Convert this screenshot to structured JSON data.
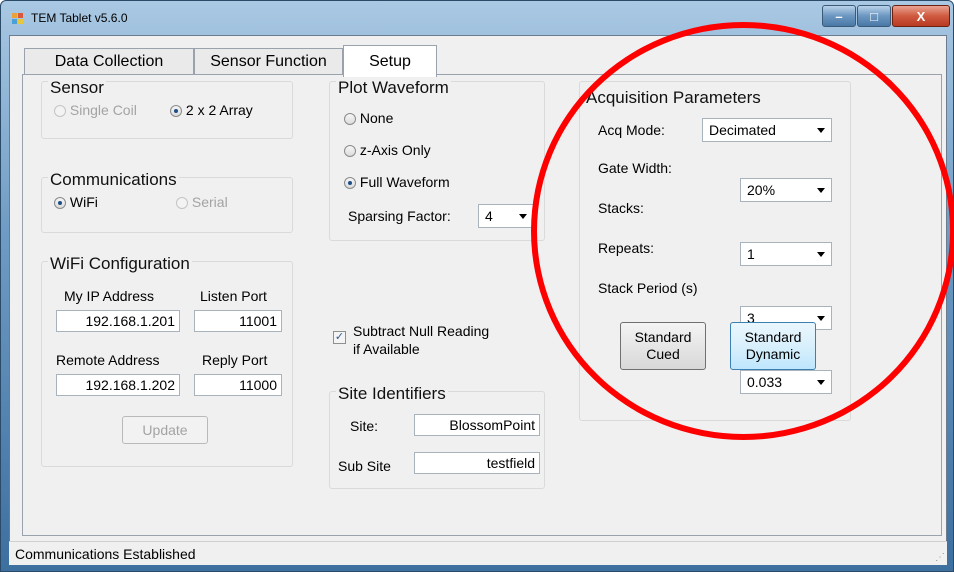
{
  "window": {
    "title": "TEM Tablet v5.6.0",
    "minimize_glyph": "–",
    "maximize_glyph": "□",
    "close_glyph": "X"
  },
  "tabs": [
    "Data Collection",
    "Sensor Function",
    "Setup"
  ],
  "sensor": {
    "title": "Sensor",
    "options": [
      "Single Coil",
      "2 x 2 Array"
    ],
    "selected": "2 x 2 Array"
  },
  "communications": {
    "title": "Communications",
    "options": [
      "WiFi",
      "Serial"
    ],
    "selected": "WiFi"
  },
  "wifi": {
    "title": "WiFi Configuration",
    "my_ip_label": "My IP Address",
    "my_ip": "192.168.1.201",
    "listen_port_label": "Listen Port",
    "listen_port": "11001",
    "remote_label": "Remote Address",
    "remote": "192.168.1.202",
    "reply_port_label": "Reply Port",
    "reply_port": "11000",
    "update_label": "Update"
  },
  "plot": {
    "title": "Plot Waveform",
    "options": [
      "None",
      "z-Axis Only",
      "Full Waveform"
    ],
    "selected": "Full Waveform",
    "sparsing_label": "Sparsing Factor:",
    "sparsing_value": "4"
  },
  "subtract": {
    "line1": "Subtract Null Reading",
    "line2": "if Available",
    "checked": true
  },
  "site": {
    "title": "Site Identifiers",
    "site_label": "Site:",
    "site_value": "BlossomPoint",
    "subsite_label": "Sub Site",
    "subsite_value": "testfield"
  },
  "acq": {
    "title": "Acquisition Parameters",
    "mode_label": "Acq Mode:",
    "mode_value": "Decimated",
    "gate_label": "Gate Width:",
    "gate_value": "20%",
    "stacks_label": "Stacks:",
    "stacks_value": "1",
    "repeats_label": "Repeats:",
    "repeats_value": "3",
    "period_label": "Stack Period (s)",
    "period_value": "0.033",
    "btn_cued_1": "Standard",
    "btn_cued_2": "Cued",
    "btn_dyn_1": "Standard",
    "btn_dyn_2": "Dynamic"
  },
  "status": {
    "text": "Communications Established"
  },
  "colors": {
    "annotation": "#ff0000",
    "accent": "#1f4f86"
  }
}
